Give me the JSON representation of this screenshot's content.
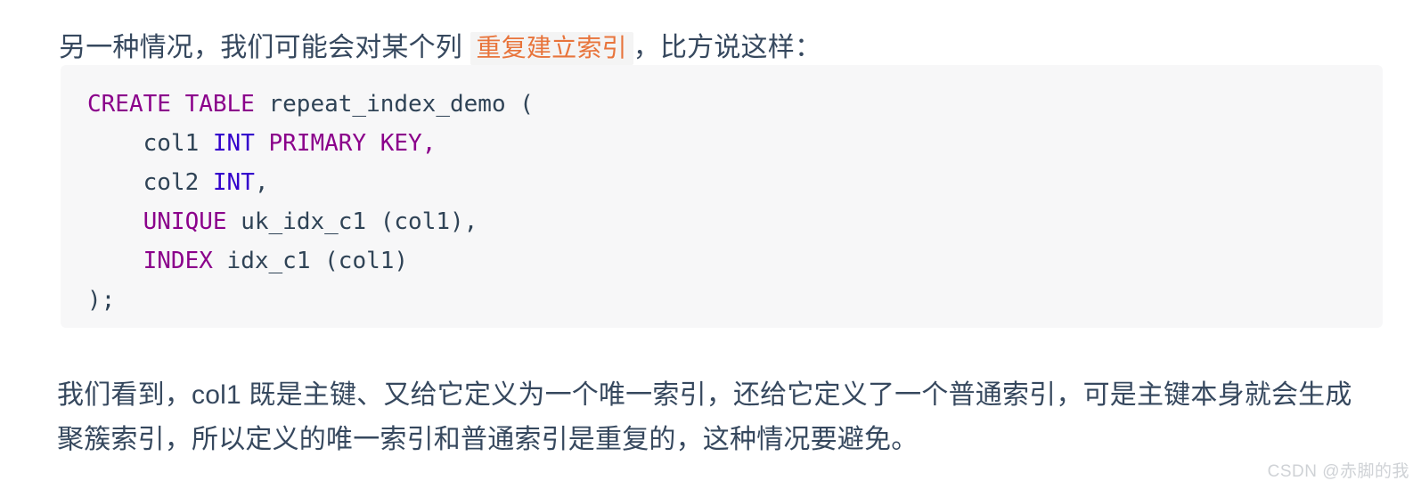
{
  "intro": {
    "before_highlight": "另一种情况，我们可能会对某个列 ",
    "highlight": "重复建立索引",
    "after_highlight": "，比方说这样：",
    "highlight_color": "#e8743b",
    "highlight_background": "#f4f4f4"
  },
  "code_block": {
    "language": "sql",
    "background": "#f7f7f8",
    "keyword_color": "#8b008b",
    "type_color": "#3300cc",
    "plain_color": "#2f4356",
    "lines": [
      {
        "id": "line-1",
        "tokens": [
          {
            "text": "CREATE TABLE",
            "kind": "keyword"
          },
          {
            "text": " repeat_index_demo (",
            "kind": "plain"
          }
        ]
      },
      {
        "id": "line-2",
        "tokens": [
          {
            "text": "    col1 ",
            "kind": "plain"
          },
          {
            "text": "INT",
            "kind": "type"
          },
          {
            "text": " ",
            "kind": "plain"
          },
          {
            "text": "PRIMARY KEY",
            "kind": "keyword"
          },
          {
            "text": ",",
            "kind": "keyword"
          }
        ]
      },
      {
        "id": "line-3",
        "tokens": [
          {
            "text": "    col2 ",
            "kind": "plain"
          },
          {
            "text": "INT",
            "kind": "type"
          },
          {
            "text": ",",
            "kind": "plain"
          }
        ]
      },
      {
        "id": "line-4",
        "tokens": [
          {
            "text": "    ",
            "kind": "plain"
          },
          {
            "text": "UNIQUE",
            "kind": "keyword"
          },
          {
            "text": " uk_idx_c1 (col1),",
            "kind": "plain"
          }
        ]
      },
      {
        "id": "line-5",
        "tokens": [
          {
            "text": "    ",
            "kind": "plain"
          },
          {
            "text": "INDEX",
            "kind": "keyword"
          },
          {
            "text": " idx_c1 (col1)",
            "kind": "plain"
          }
        ]
      },
      {
        "id": "line-6",
        "tokens": [
          {
            "text": ");",
            "kind": "plain"
          }
        ]
      }
    ]
  },
  "closing": {
    "text": "我们看到，col1 既是主键、又给它定义为一个唯一索引，还给它定义了一个普通索引，可是主键本身就会生成聚簇索引，所以定义的唯一索引和普通索引是重复的，这种情况要避免。"
  },
  "watermark": {
    "text": "CSDN @赤脚的我"
  }
}
